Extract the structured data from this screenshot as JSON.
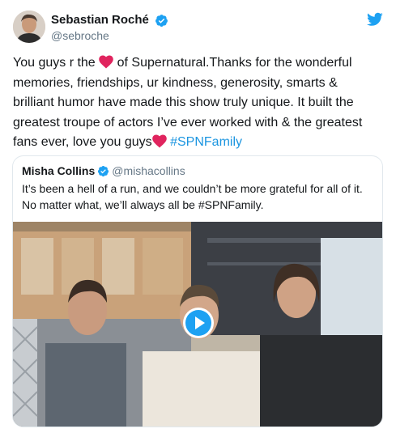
{
  "author": {
    "display_name": "Sebastian Roché",
    "handle": "@sebroche"
  },
  "tweet": {
    "text_part1": "You guys r the ",
    "text_part2": " of Supernatural.Thanks for the wonderful memories, friendships, ur kindness, generosity, smarts & brilliant humor have made this show truly unique. It built the greatest troupe of actors I’ve ever worked with & the greatest fans ever, love you guys",
    "hashtag": "#SPNFamily"
  },
  "quoted_tweet": {
    "display_name": "Misha Collins",
    "handle": "@mishacollins",
    "text": "It’s been a hell of a run, and we couldn’t be more grateful for all of it. No matter what, we’ll always all be #SPNFamily."
  },
  "colors": {
    "link": "#1b95e0",
    "verified": "#1da1f2",
    "heart": "#e0245e",
    "twitter_brand": "#1da1f2"
  },
  "icons": {
    "verified": "verified-badge-icon",
    "brand": "twitter-bird-icon",
    "heart": "heart-emoji-icon",
    "play": "play-icon"
  }
}
